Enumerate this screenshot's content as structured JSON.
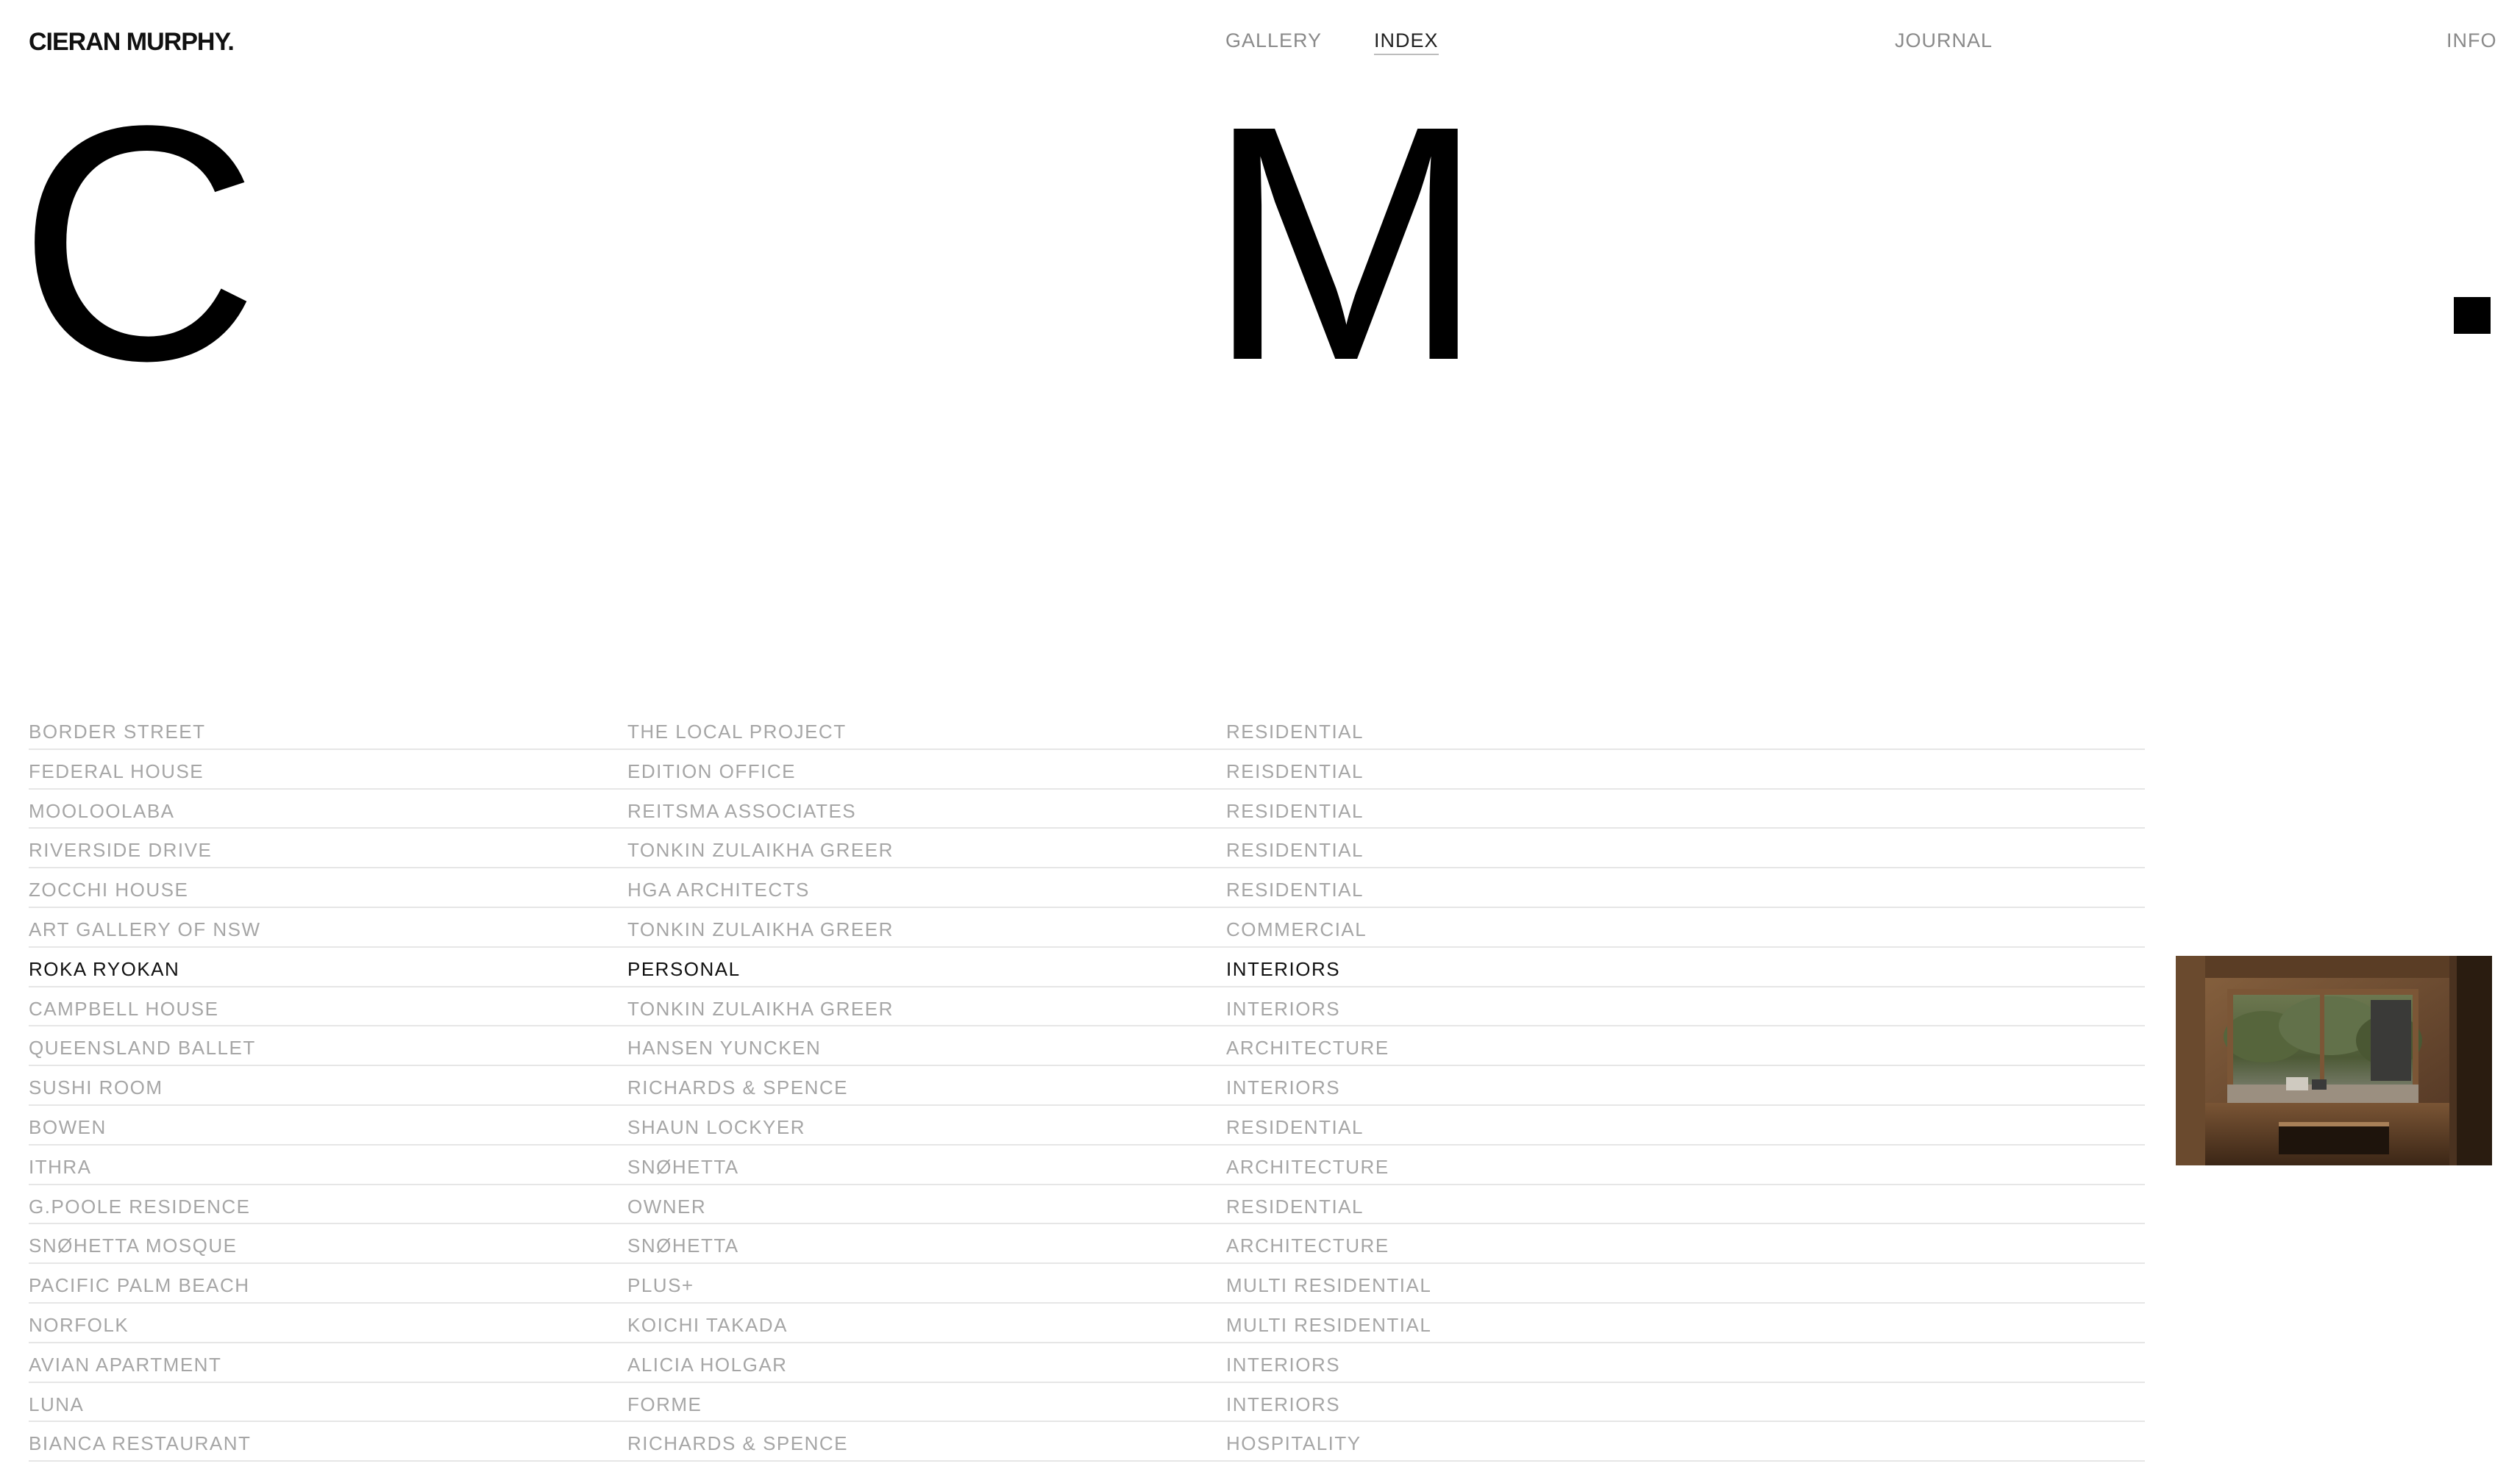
{
  "header": {
    "logo": "CIERAN MURPHY.",
    "nav": {
      "gallery": "GALLERY",
      "index": "INDEX",
      "journal": "JOURNAL",
      "info": "INFO"
    },
    "active_nav": "INDEX"
  },
  "hero": {
    "letter_1": "C",
    "letter_2": "M"
  },
  "index": {
    "active_row": 6,
    "rows": [
      {
        "project": "BORDER STREET",
        "client": "THE LOCAL PROJECT",
        "category": "RESIDENTIAL"
      },
      {
        "project": "FEDERAL HOUSE",
        "client": "EDITION OFFICE",
        "category": "REISDENTIAL"
      },
      {
        "project": "MOOLOOLABA",
        "client": "REITSMA ASSOCIATES",
        "category": "RESIDENTIAL"
      },
      {
        "project": "RIVERSIDE DRIVE",
        "client": "TONKIN ZULAIKHA GREER",
        "category": "RESIDENTIAL"
      },
      {
        "project": "ZOCCHI HOUSE",
        "client": "HGA ARCHITECTS",
        "category": "RESIDENTIAL"
      },
      {
        "project": "ART GALLERY OF NSW",
        "client": "TONKIN ZULAIKHA GREER",
        "category": "COMMERCIAL"
      },
      {
        "project": "ROKA RYOKAN",
        "client": "PERSONAL",
        "category": "INTERIORS"
      },
      {
        "project": "CAMPBELL HOUSE",
        "client": "TONKIN ZULAIKHA GREER",
        "category": "INTERIORS"
      },
      {
        "project": "QUEENSLAND BALLET",
        "client": "HANSEN YUNCKEN",
        "category": "ARCHITECTURE"
      },
      {
        "project": "SUSHI ROOM",
        "client": "RICHARDS & SPENCE",
        "category": "INTERIORS"
      },
      {
        "project": "BOWEN",
        "client": "SHAUN LOCKYER",
        "category": "RESIDENTIAL"
      },
      {
        "project": "ITHRA",
        "client": "SNØHETTA",
        "category": "ARCHITECTURE"
      },
      {
        "project": "G.POOLE RESIDENCE",
        "client": "OWNER",
        "category": "RESIDENTIAL"
      },
      {
        "project": "SNØHETTA MOSQUE",
        "client": "SNØHETTA",
        "category": "ARCHITECTURE"
      },
      {
        "project": "PACIFIC PALM BEACH",
        "client": "PLUS+",
        "category": "MULTI RESIDENTIAL"
      },
      {
        "project": "NORFOLK",
        "client": "KOICHI TAKADA",
        "category": "MULTI RESIDENTIAL"
      },
      {
        "project": "AVIAN APARTMENT",
        "client": "ALICIA HOLGAR",
        "category": "INTERIORS"
      },
      {
        "project": "LUNA",
        "client": "FORME",
        "category": "INTERIORS"
      },
      {
        "project": "BIANCA RESTAURANT",
        "client": "RICHARDS & SPENCE",
        "category": "HOSPITALITY"
      }
    ]
  },
  "colors": {
    "text_active": "#111111",
    "text_muted": "#a6a6a6",
    "divider": "#e6e6e6"
  }
}
